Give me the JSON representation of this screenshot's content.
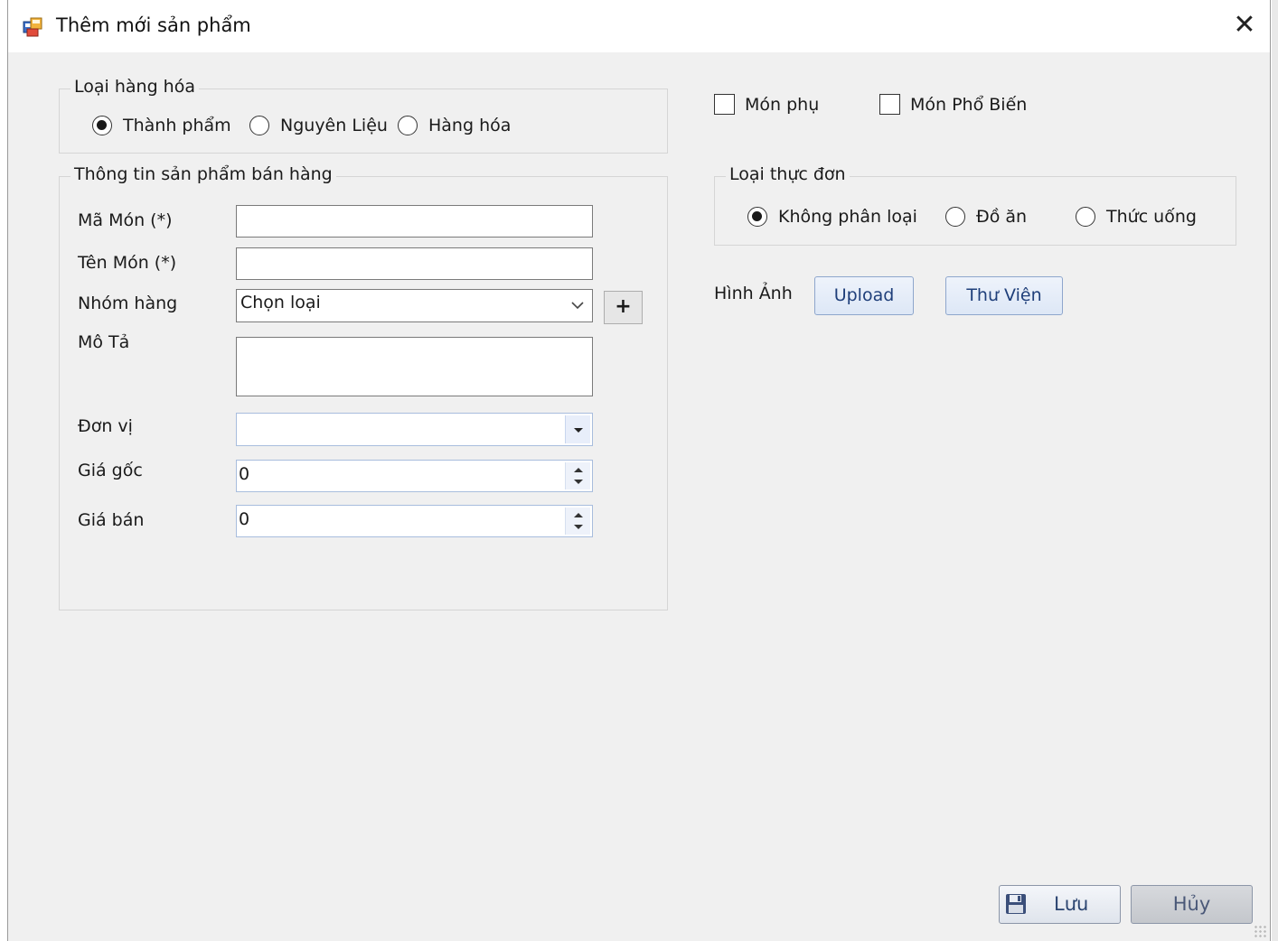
{
  "window": {
    "title": "Thêm mới sản phẩm",
    "close_glyph": "✕",
    "app_icon": "form-app-icon"
  },
  "product_type": {
    "legend": "Loại hàng hóa",
    "options": [
      "Thành phẩm",
      "Nguyên Liệu",
      "Hàng hóa"
    ],
    "selected": "Thành phẩm"
  },
  "product_info": {
    "legend": "Thông tin sản phẩm bán hàng",
    "code_label": "Mã Món (*)",
    "code_value": "",
    "name_label": "Tên Món (*)",
    "name_value": "",
    "group_label": "Nhóm hàng",
    "group_value": "Chọn loại",
    "add_group_glyph": "+",
    "description_label": "Mô Tả",
    "description_value": "",
    "unit_label": "Đơn vị",
    "unit_value": "",
    "cost_label": "Giá gốc",
    "cost_value": "0",
    "price_label": "Giá bán",
    "price_value": "0"
  },
  "flags": {
    "side_dish_label": "Món phụ",
    "side_dish_checked": false,
    "popular_label": "Món Phổ Biến",
    "popular_checked": false
  },
  "menu_type": {
    "legend": "Loại thực đơn",
    "options": [
      "Không phân loại",
      "Đồ ăn",
      "Thức uống"
    ],
    "selected": "Không phân loại"
  },
  "image": {
    "label": "Hình Ảnh",
    "upload_label": "Upload",
    "library_label": "Thư Viện"
  },
  "footer": {
    "save_label": "Lưu",
    "save_icon": "floppy-disk-icon",
    "cancel_label": "Hủy"
  },
  "colors": {
    "window_bg": "#f0f0f0",
    "button_border": "#8ea6cc",
    "button_text": "#1f3f7a"
  }
}
